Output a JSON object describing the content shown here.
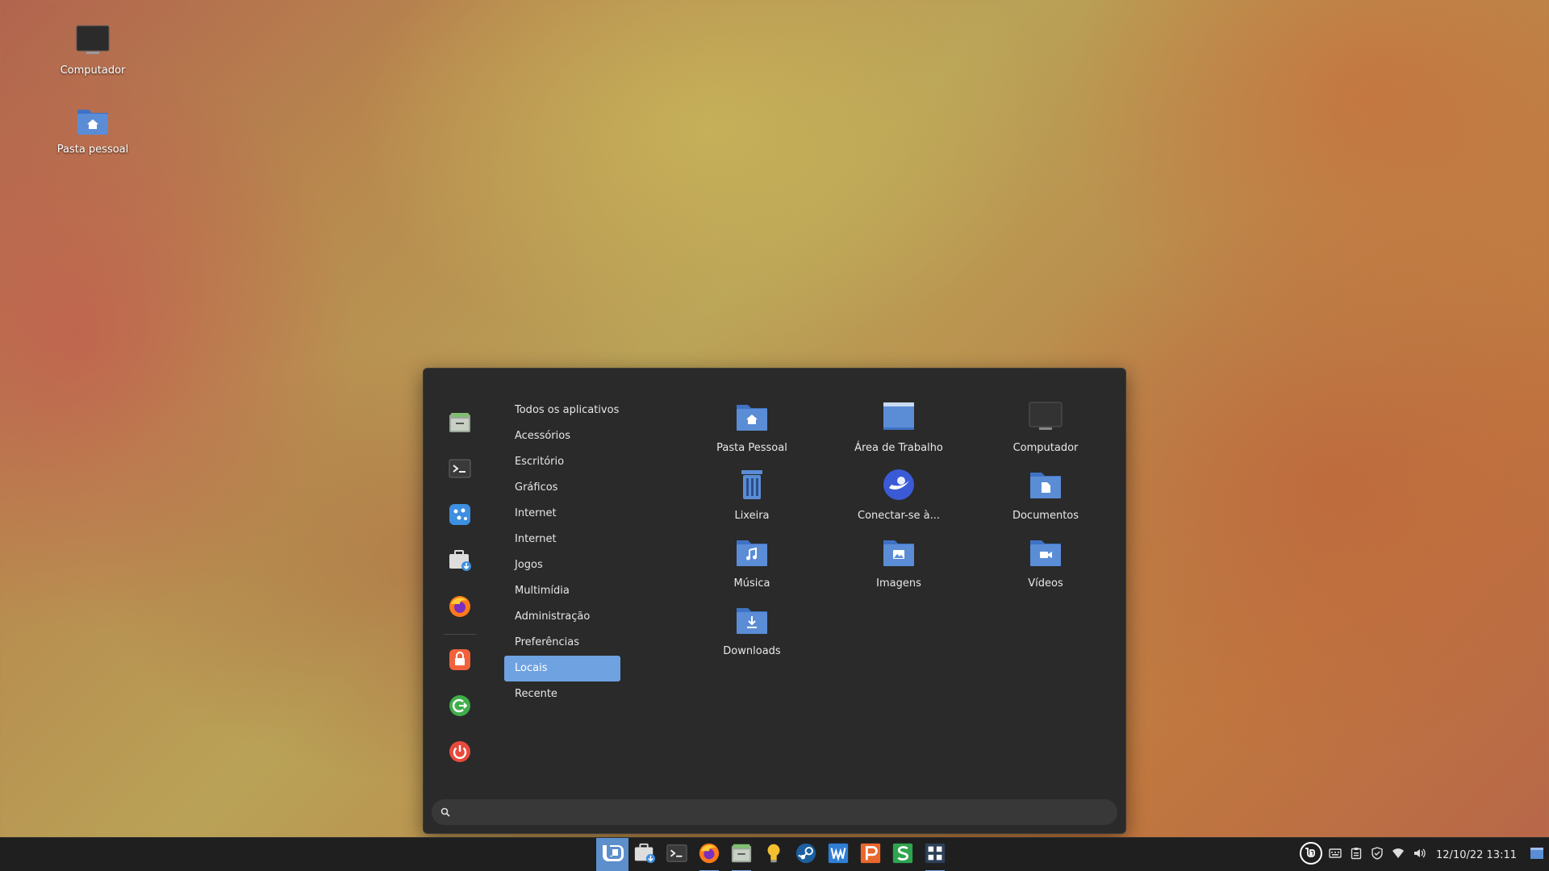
{
  "desktop": {
    "icons": [
      {
        "label": "Computador",
        "icon": "monitor-icon"
      },
      {
        "label": "Pasta pessoal",
        "icon": "home-folder-icon"
      }
    ]
  },
  "menu": {
    "favorites": [
      {
        "icon": "file-manager-icon"
      },
      {
        "icon": "terminal-icon"
      },
      {
        "icon": "software-manager-icon"
      },
      {
        "icon": "update-manager-icon"
      },
      {
        "icon": "firefox-icon"
      }
    ],
    "session": [
      {
        "icon": "lock-screen-icon"
      },
      {
        "icon": "logout-icon"
      },
      {
        "icon": "power-icon"
      }
    ],
    "categories": [
      {
        "label": "Todos os aplicativos"
      },
      {
        "label": "Acessórios"
      },
      {
        "label": "Escritório"
      },
      {
        "label": "Gráficos"
      },
      {
        "label": "Internet"
      },
      {
        "label": "Internet"
      },
      {
        "label": "Jogos"
      },
      {
        "label": "Multimídia"
      },
      {
        "label": "Administração"
      },
      {
        "label": "Preferências"
      },
      {
        "label": "Locais"
      },
      {
        "label": "Recente"
      }
    ],
    "active_category": "Locais",
    "places": [
      {
        "label": "Pasta Pessoal",
        "icon": "home-folder-icon"
      },
      {
        "label": "Área de Trabalho",
        "icon": "desktop-folder-icon"
      },
      {
        "label": "Computador",
        "icon": "monitor-icon"
      },
      {
        "label": "Lixeira",
        "icon": "trash-icon"
      },
      {
        "label": "Conectar-se à...",
        "icon": "network-icon"
      },
      {
        "label": "Documentos",
        "icon": "documents-folder-icon"
      },
      {
        "label": "Música",
        "icon": "music-folder-icon"
      },
      {
        "label": "Imagens",
        "icon": "pictures-folder-icon"
      },
      {
        "label": "Vídeos",
        "icon": "videos-folder-icon"
      },
      {
        "label": "Downloads",
        "icon": "downloads-folder-icon"
      }
    ],
    "search": {
      "value": "",
      "placeholder": ""
    }
  },
  "panel": {
    "launchers": [
      {
        "icon": "mint-menu-icon"
      },
      {
        "icon": "update-manager-icon"
      },
      {
        "icon": "terminal-icon"
      },
      {
        "icon": "firefox-icon"
      },
      {
        "icon": "file-manager-icon"
      },
      {
        "icon": "lightbulb-icon"
      },
      {
        "icon": "steam-icon"
      },
      {
        "icon": "writer-icon"
      },
      {
        "icon": "presentation-icon"
      },
      {
        "icon": "spreadsheet-icon"
      },
      {
        "icon": "apps-grid-icon"
      }
    ],
    "tray": [
      {
        "icon": "mint-logo-icon"
      },
      {
        "icon": "keyboard-icon"
      },
      {
        "icon": "clipboard-icon"
      },
      {
        "icon": "shield-icon"
      },
      {
        "icon": "wifi-icon"
      },
      {
        "icon": "volume-icon"
      }
    ],
    "clock": "12/10/22 13:11",
    "show_desktop_icon": "show-desktop-icon"
  },
  "colors": {
    "accent": "#6fa2e0",
    "menu_bg": "#2a2a2a",
    "panel_bg": "#1f1f1f",
    "folder_blue": "#5b8dd6"
  }
}
